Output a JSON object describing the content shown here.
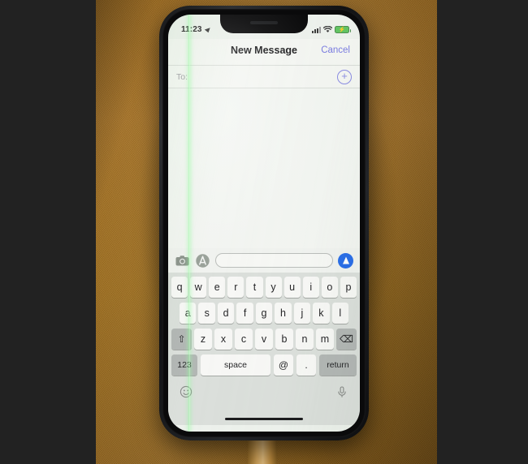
{
  "scene": {
    "subject": "photo of smartphone on fabric",
    "background_color": "#a9762a",
    "letterbox_color": "#222222",
    "cable_color": "#c59a54"
  },
  "device": {
    "body_color": "#17181a",
    "screen_defect": "green-vertical-line",
    "defect_color": "#96fa9f"
  },
  "status_bar": {
    "time": "11:23",
    "location_icon": "location-arrow-icon",
    "signal_icon": "cellular-signal-icon",
    "wifi_icon": "wifi-icon",
    "battery_icon": "battery-charging-icon",
    "battery_color": "#62c463",
    "charging_glyph": "⚡"
  },
  "nav_bar": {
    "title": "New Message",
    "cancel_label": "Cancel",
    "cancel_color": "#7a7ce0"
  },
  "to_field": {
    "label": "To:",
    "value": "",
    "placeholder": "",
    "add_contact_icon": "plus-circle-icon",
    "add_contact_glyph": "+",
    "accent_color": "#8a8ce2"
  },
  "input_bar": {
    "camera_icon": "camera-icon",
    "appstore_icon": "app-store-icon",
    "message_value": "",
    "message_placeholder": "",
    "send_icon": "send-arrow-up-icon",
    "send_color": "#2a6fe8"
  },
  "keyboard": {
    "row1": [
      "q",
      "w",
      "e",
      "r",
      "t",
      "y",
      "u",
      "i",
      "o",
      "p"
    ],
    "row2": [
      "a",
      "s",
      "d",
      "f",
      "g",
      "h",
      "j",
      "k",
      "l"
    ],
    "row3": [
      "z",
      "x",
      "c",
      "v",
      "b",
      "n",
      "m"
    ],
    "shift_glyph": "⇧",
    "backspace_glyph": "⌫",
    "numbers_label": "123",
    "space_label": "space",
    "at_label": "@",
    "period_label": ".",
    "return_label": "return",
    "emoji_icon": "emoji-smiley-icon",
    "emoji_glyph": "☺",
    "mic_icon": "microphone-icon"
  }
}
